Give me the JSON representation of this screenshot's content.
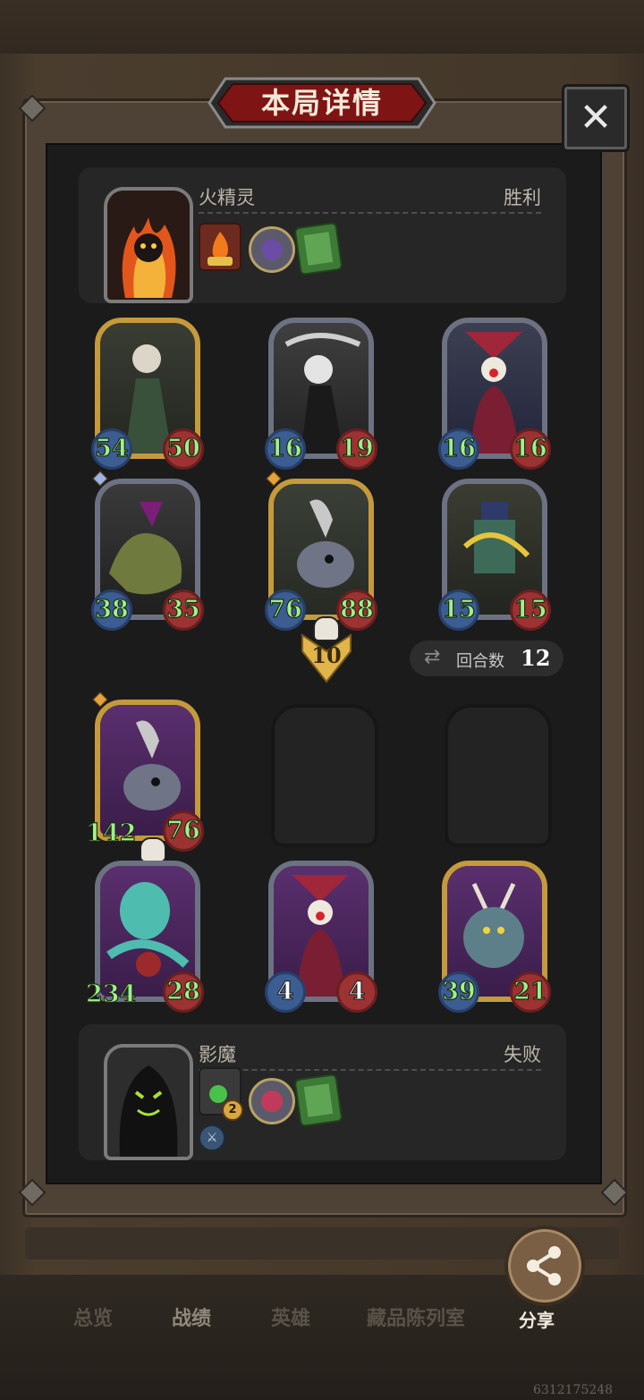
{
  "dialog": {
    "title": "本局详情",
    "close_icon": "close-icon"
  },
  "player_top": {
    "name": "火精灵",
    "result": "胜利",
    "items": [
      "fire-relic-icon",
      "orb-icon",
      "green-book-icon"
    ]
  },
  "player_bottom": {
    "name": "影魔",
    "result": "失败",
    "items": [
      "green-spirit-icon",
      "pink-orb-icon",
      "green-book-icon"
    ],
    "item_badge": "2"
  },
  "top_cards": [
    {
      "atk": "54",
      "hp": "50",
      "frame": "gold"
    },
    {
      "atk": "16",
      "hp": "19",
      "frame": "silver"
    },
    {
      "atk": "16",
      "hp": "16",
      "frame": "silver"
    },
    {
      "atk": "38",
      "hp": "35",
      "frame": "silver"
    },
    {
      "atk": "76",
      "hp": "88",
      "frame": "gold"
    },
    {
      "atk": "15",
      "hp": "15",
      "frame": "silver"
    }
  ],
  "attack_arrow": {
    "value": "10"
  },
  "rounds": {
    "label": "回合数",
    "value": "12"
  },
  "bottom_cards": [
    {
      "atk": "142",
      "hp": "76",
      "frame": "gold"
    },
    {
      "atk": "234",
      "hp": "28",
      "frame": "silver"
    },
    {
      "atk": "4",
      "hp": "4",
      "frame": "silver"
    },
    {
      "atk": "39",
      "hp": "21",
      "frame": "gold"
    }
  ],
  "bottom_nav": {
    "tabs": [
      "总览",
      "战绩",
      "英雄",
      "藏品陈列室"
    ],
    "share_label": "分享"
  },
  "version": "6312175248"
}
